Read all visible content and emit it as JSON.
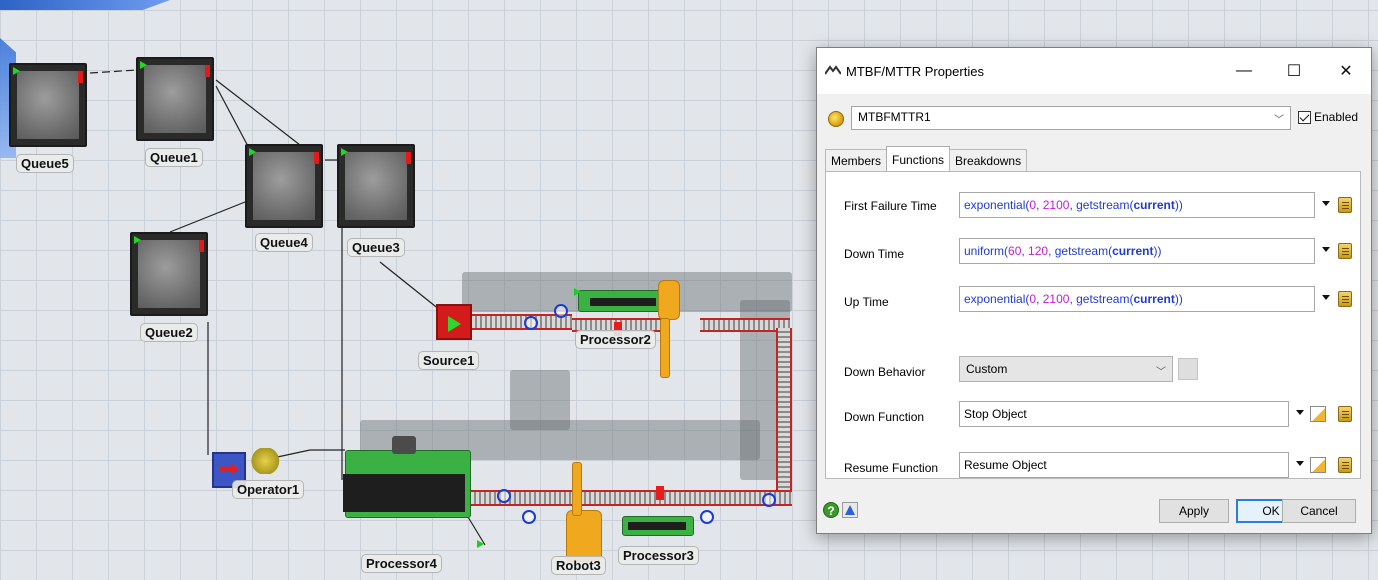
{
  "model": {
    "objects": {
      "queue5": "Queue5",
      "queue1": "Queue1",
      "queue4": "Queue4",
      "queue3": "Queue3",
      "queue2": "Queue2",
      "source1": "Source1",
      "processor2": "Processor2",
      "operator1": "Operator1",
      "processor4": "Processor4",
      "robot3": "Robot3",
      "processor3": "Processor3"
    }
  },
  "dialog": {
    "title": "MTBF/MTTR Properties",
    "object_name": "MTBFMTTR1",
    "enabled_label": "Enabled",
    "enabled": true,
    "tabs": [
      "Members",
      "Functions",
      "Breakdowns"
    ],
    "active_tab": "Functions",
    "fields": {
      "first_failure": {
        "label": "First Failure Time",
        "fn": "exponential(",
        "a": "0",
        "sep1": ", ",
        "b": "2100",
        "sep2": ", getstream(",
        "kw": "current",
        "end": "))"
      },
      "down_time": {
        "label": "Down Time",
        "fn": "uniform(",
        "a": "60",
        "sep1": ", ",
        "b": "120",
        "sep2": ", getstream(",
        "kw": "current",
        "end": "))"
      },
      "up_time": {
        "label": "Up Time",
        "fn": "exponential(",
        "a": "0",
        "sep1": ", ",
        "b": "2100",
        "sep2": ", getstream(",
        "kw": "current",
        "end": "))"
      },
      "down_behavior": {
        "label": "Down Behavior",
        "value": "Custom"
      },
      "down_function": {
        "label": "Down Function",
        "value": "Stop Object"
      },
      "resume_function": {
        "label": "Resume Function",
        "value": "Resume Object"
      }
    },
    "buttons": {
      "apply": "Apply",
      "ok": "OK",
      "cancel": "Cancel"
    },
    "window_controls": {
      "minimize": "—",
      "maximize": "☐",
      "close": "✕"
    }
  }
}
